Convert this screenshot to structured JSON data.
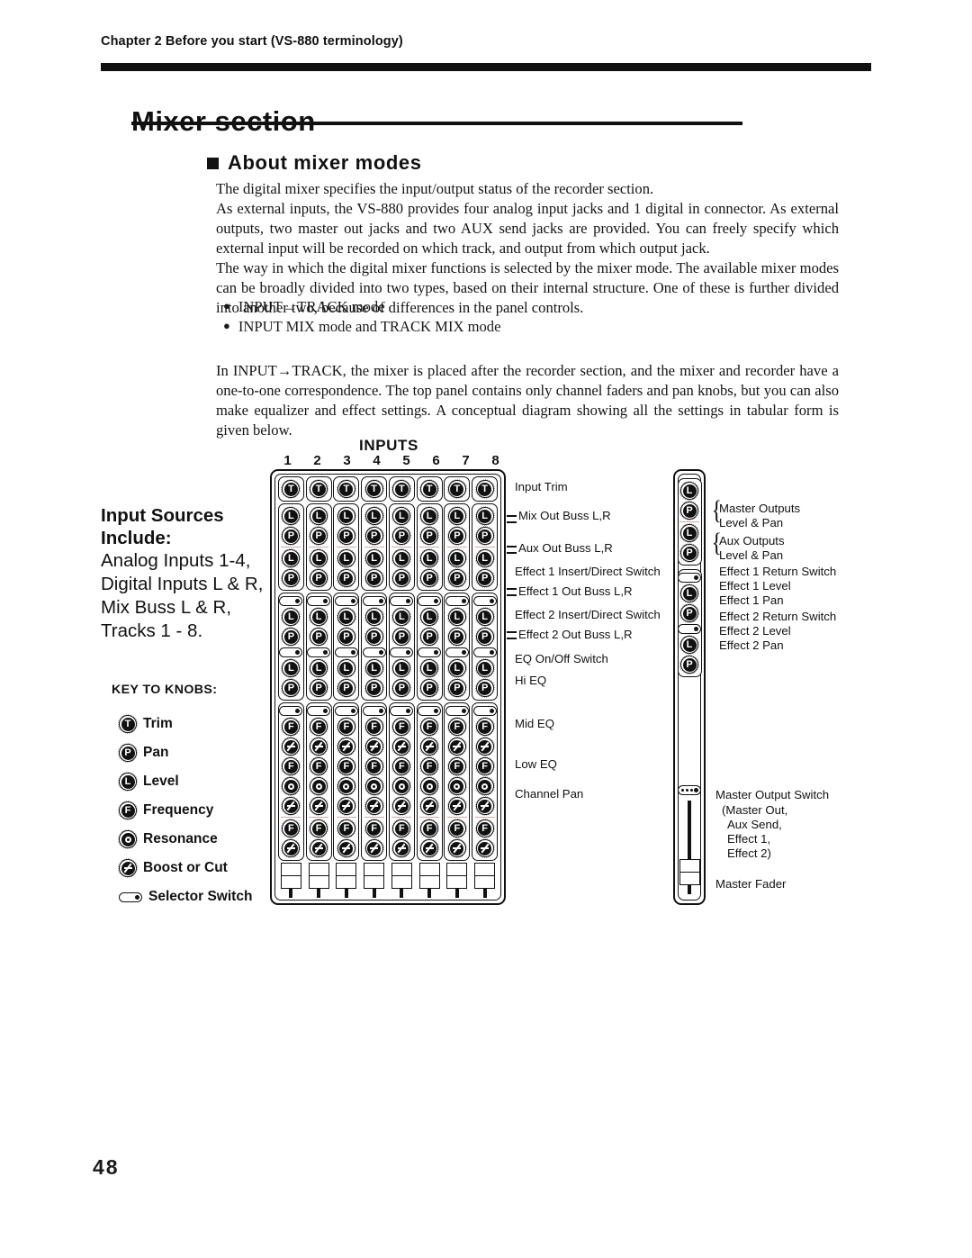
{
  "running_head": "Chapter 2  Before you start (VS-880 terminology)",
  "page_title": "Mixer section",
  "section_title": "About mixer modes",
  "paragraphs": {
    "p1": "The digital mixer specifies the input/output status of the recorder section.",
    "p2": "As external inputs, the VS-880 provides four analog input jacks and 1 digital in connector. As external outputs, two master out jacks and two AUX send jacks are provided. You can freely specify which external input will be recorded on which track, and output from which output jack.",
    "p3": "The way in which the digital mixer functions is selected by the mixer mode. The available mixer modes can be broadly divided into two types, based on their internal structure. One of these is further divided into another two, because of differences in the panel controls.",
    "p4": "In INPUT→TRACK, the mixer is placed after the recorder section, and the mixer and recorder have a one-to-one correspondence. The top panel contains only channel faders and pan knobs, but you can also make equalizer and effect settings. A conceptual diagram showing all the settings in tabular form is given below."
  },
  "bullets": [
    "INPUT→TRACK mode",
    "INPUT MIX mode and TRACK MIX mode"
  ],
  "sidebar": {
    "heading_line1": "Input Sources",
    "heading_line2": "Include:",
    "lines": [
      "Analog Inputs 1-4,",
      "Digital Inputs L & R,",
      "Mix Buss L & R,",
      "Tracks 1 - 8."
    ]
  },
  "key_to_knobs": {
    "title": "KEY TO KNOBS:",
    "items": [
      {
        "glyph": "T",
        "label": "Trim",
        "icon": "trim-knob-icon"
      },
      {
        "glyph": "P",
        "label": "Pan",
        "icon": "pan-knob-icon"
      },
      {
        "glyph": "L",
        "label": "Level",
        "icon": "level-knob-icon"
      },
      {
        "glyph": "F",
        "label": "Frequency",
        "icon": "frequency-knob-icon"
      },
      {
        "glyph": "O",
        "label": "Resonance",
        "icon": "resonance-knob-icon"
      },
      {
        "glyph": "Z",
        "label": "Boost or Cut",
        "icon": "boost-cut-knob-icon"
      },
      {
        "glyph": "S",
        "label": "Selector Switch",
        "icon": "selector-switch-icon"
      }
    ]
  },
  "diagram": {
    "inputs_label": "INPUTS",
    "channel_numbers": [
      "1",
      "2",
      "3",
      "4",
      "5",
      "6",
      "7",
      "8"
    ],
    "channel_labels": [
      "Input Trim",
      "Mix Out Buss L,R",
      "Aux Out Buss L,R",
      "Effect 1 Insert/Direct Switch",
      "Effect 1 Out Buss L,R",
      "Effect 2 Insert/Direct Switch",
      "Effect 2 Out Buss L,R",
      "EQ On/Off Switch",
      "Hi EQ",
      "Mid EQ",
      "Low EQ",
      "Channel Pan"
    ],
    "master_labels": [
      "Master Outputs",
      "Level & Pan",
      "Aux Outputs",
      "Level & Pan",
      "Effect 1 Return Switch",
      "Effect 1 Level",
      "Effect 1 Pan",
      "Effect 2 Return Switch",
      "Effect 2 Level",
      "Effect 2 Pan",
      "Master Output Switch",
      "(Master Out,",
      "Aux Send,",
      "Effect 1,",
      "Effect 2)",
      "Master Fader"
    ]
  },
  "page_number": "48"
}
